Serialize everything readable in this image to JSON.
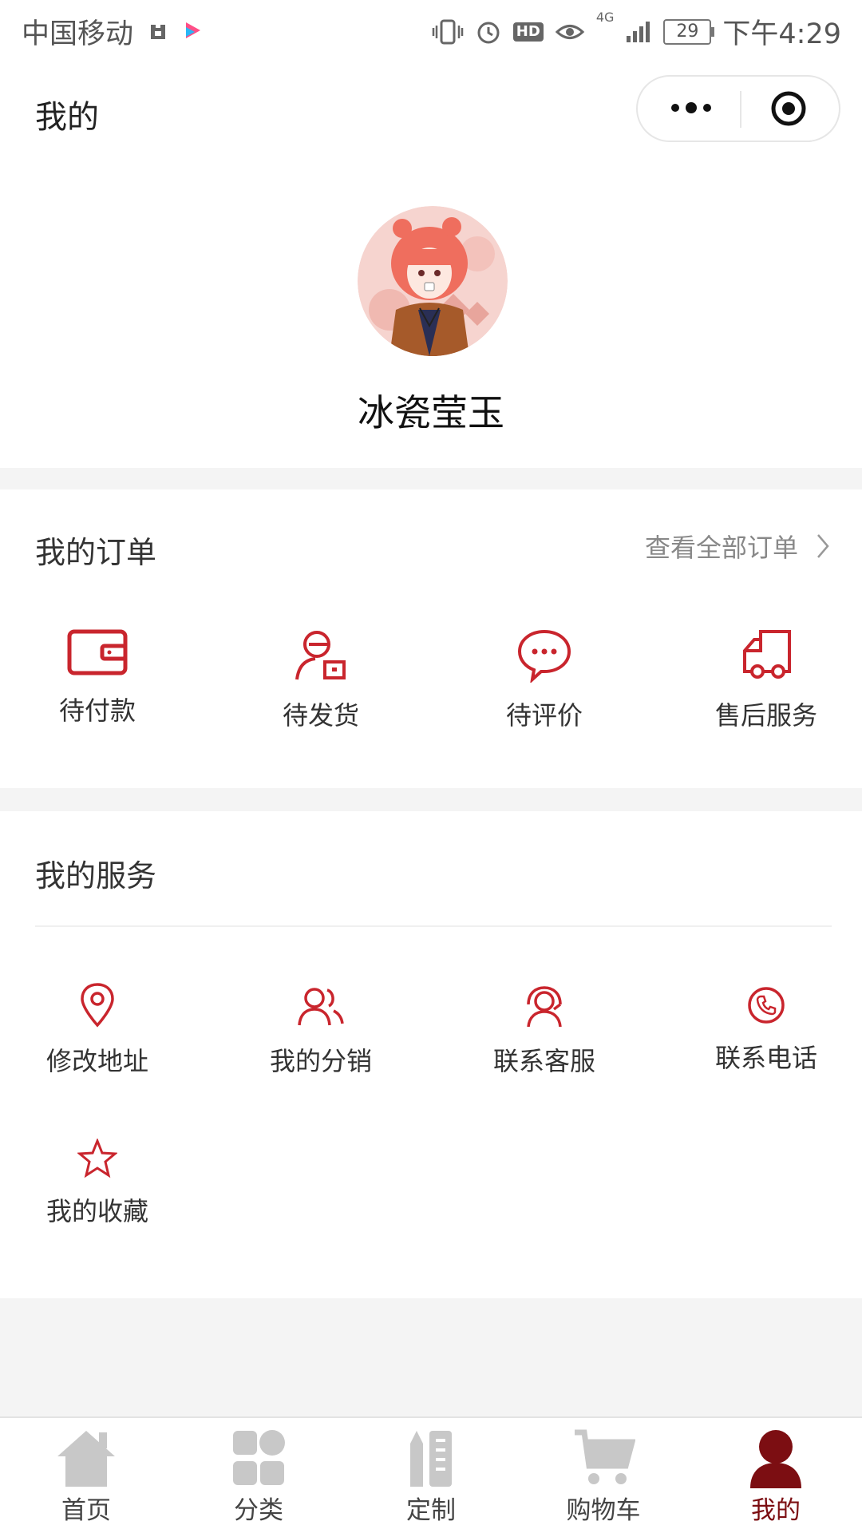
{
  "status_bar": {
    "carrier": "中国移动",
    "network": "4G",
    "battery": "29",
    "time": "下午4:29",
    "hd_label": "HD"
  },
  "nav": {
    "title": "我的"
  },
  "profile": {
    "username": "冰瓷莹玉"
  },
  "orders": {
    "title": "我的订单",
    "view_all": "查看全部订单",
    "items": [
      {
        "label": "待付款",
        "icon": "wallet-icon"
      },
      {
        "label": "待发货",
        "icon": "person-package-icon"
      },
      {
        "label": "待评价",
        "icon": "comment-icon"
      },
      {
        "label": "售后服务",
        "icon": "truck-icon"
      }
    ]
  },
  "services": {
    "title": "我的服务",
    "items": [
      {
        "label": "修改地址",
        "icon": "location-pin-icon"
      },
      {
        "label": "我的分销",
        "icon": "users-icon"
      },
      {
        "label": "联系客服",
        "icon": "headset-icon"
      },
      {
        "label": "联系电话",
        "icon": "phone-icon"
      },
      {
        "label": "我的收藏",
        "icon": "star-icon"
      }
    ]
  },
  "tab_bar": {
    "tabs": [
      {
        "label": "首页",
        "icon": "home-icon"
      },
      {
        "label": "分类",
        "icon": "category-grid-icon"
      },
      {
        "label": "定制",
        "icon": "customize-icon"
      },
      {
        "label": "购物车",
        "icon": "cart-icon"
      },
      {
        "label": "我的",
        "icon": "user-icon",
        "active": true
      }
    ]
  },
  "colors": {
    "accent": "#c9252d",
    "active_tab": "#7c0e12",
    "inactive_tab_icon": "#c8c8c8",
    "page_background": "#f4f4f4"
  }
}
